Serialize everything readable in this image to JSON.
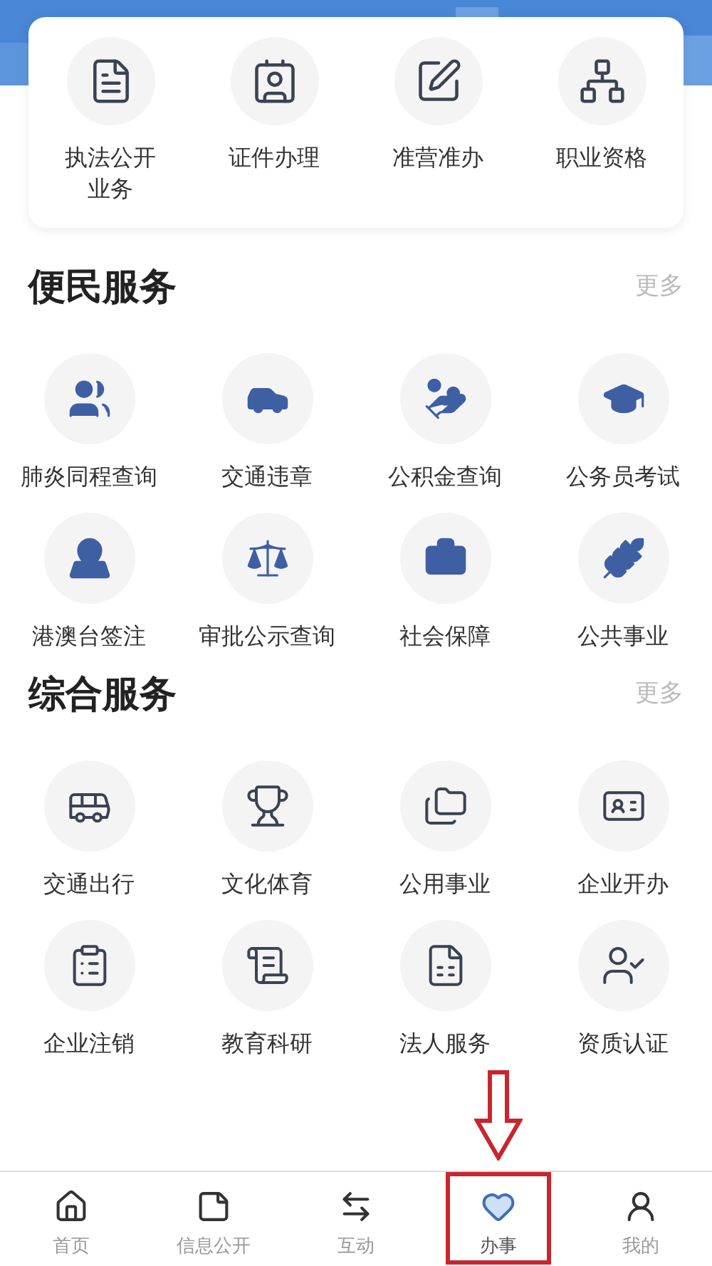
{
  "quick_links": [
    {
      "label": "执法公开业务"
    },
    {
      "label": "证件办理"
    },
    {
      "label": "准营准办"
    },
    {
      "label": "职业资格"
    }
  ],
  "sections": [
    {
      "title": "便民服务",
      "more": "更多",
      "kind": "filled",
      "items": [
        {
          "label": "肺炎同程查询"
        },
        {
          "label": "交通违章"
        },
        {
          "label": "公积金查询"
        },
        {
          "label": "公务员考试"
        },
        {
          "label": "港澳台签注"
        },
        {
          "label": "审批公示查询"
        },
        {
          "label": "社会保障"
        },
        {
          "label": "公共事业"
        }
      ]
    },
    {
      "title": "综合服务",
      "more": "更多",
      "kind": "outline",
      "items": [
        {
          "label": "交通出行"
        },
        {
          "label": "文化体育"
        },
        {
          "label": "公用事业"
        },
        {
          "label": "企业开办"
        },
        {
          "label": "企业注销"
        },
        {
          "label": "教育科研"
        },
        {
          "label": "法人服务"
        },
        {
          "label": "资质认证"
        }
      ]
    }
  ],
  "tabs": [
    {
      "label": "首页",
      "selected": false,
      "highlighted": false
    },
    {
      "label": "信息公开",
      "selected": false,
      "highlighted": false
    },
    {
      "label": "互动",
      "selected": false,
      "highlighted": false
    },
    {
      "label": "办事",
      "selected": true,
      "highlighted": true
    },
    {
      "label": "我的",
      "selected": false,
      "highlighted": false
    }
  ]
}
